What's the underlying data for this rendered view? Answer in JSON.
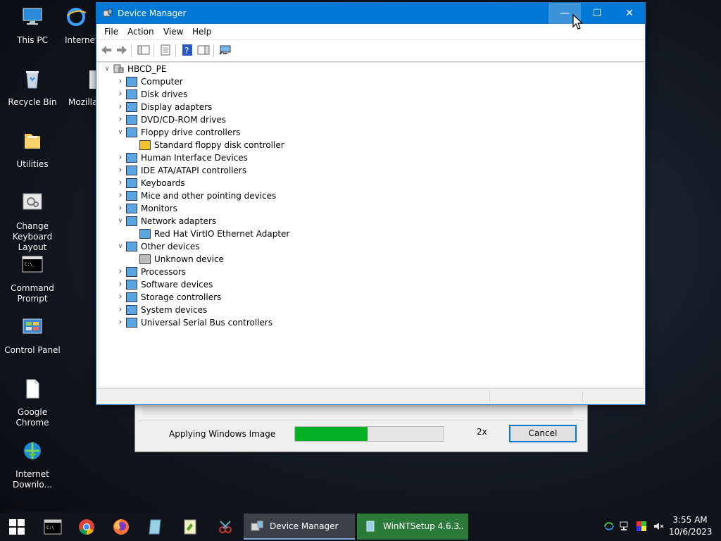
{
  "desktop": {
    "icons": [
      {
        "label": "This PC",
        "icon": "computer-icon"
      },
      {
        "label": "Internet",
        "icon": "internet-explorer-icon"
      },
      {
        "label": "Recycle Bin",
        "icon": "recycle-bin-icon"
      },
      {
        "label": "Mozilla",
        "icon": "mozilla-icon"
      },
      {
        "label": "Utilities",
        "icon": "folder-icon"
      },
      {
        "label": "Change Keyboard Layout",
        "icon": "keyboard-icon"
      },
      {
        "label": "Command Prompt",
        "icon": "terminal-icon"
      },
      {
        "label": "Control Panel",
        "icon": "control-panel-icon"
      },
      {
        "label": "Google Chrome",
        "icon": "file-icon"
      },
      {
        "label": "Internet Downlo...",
        "icon": "download-manager-icon"
      }
    ]
  },
  "background_window": {
    "status_label": "Applying Windows Image",
    "progress_fraction": 0.49,
    "speed_label": "2x",
    "cancel_label": "Cancel",
    "progress_color": "#06b025"
  },
  "device_manager": {
    "title": "Device Manager",
    "menu": [
      "File",
      "Action",
      "View",
      "Help"
    ],
    "toolbar": [
      "back-icon",
      "forward-icon",
      "show-hide-tree-icon",
      "properties-icon",
      "help-icon",
      "action-pane-icon",
      "scan-hardware-icon"
    ],
    "root": "HBCD_PE",
    "tree": [
      {
        "label": "Computer",
        "expanded": false,
        "icon": "monitor-icon",
        "children": []
      },
      {
        "label": "Disk drives",
        "expanded": false,
        "icon": "disk-drive-icon",
        "children": []
      },
      {
        "label": "Display adapters",
        "expanded": false,
        "icon": "display-adapter-icon",
        "children": []
      },
      {
        "label": "DVD/CD-ROM drives",
        "expanded": false,
        "icon": "dvd-drive-icon",
        "children": []
      },
      {
        "label": "Floppy drive controllers",
        "expanded": true,
        "icon": "floppy-controller-icon",
        "children": [
          {
            "label": "Standard floppy disk controller",
            "icon": "warning-device-icon"
          }
        ]
      },
      {
        "label": "Human Interface Devices",
        "expanded": false,
        "icon": "hid-icon",
        "children": []
      },
      {
        "label": "IDE ATA/ATAPI controllers",
        "expanded": false,
        "icon": "ide-controller-icon",
        "children": []
      },
      {
        "label": "Keyboards",
        "expanded": false,
        "icon": "keyboard-icon",
        "children": []
      },
      {
        "label": "Mice and other pointing devices",
        "expanded": false,
        "icon": "mouse-icon",
        "children": []
      },
      {
        "label": "Monitors",
        "expanded": false,
        "icon": "monitor-icon",
        "children": []
      },
      {
        "label": "Network adapters",
        "expanded": true,
        "icon": "network-adapter-icon",
        "children": [
          {
            "label": "Red Hat VirtIO Ethernet Adapter",
            "icon": "network-adapter-icon"
          }
        ]
      },
      {
        "label": "Other devices",
        "expanded": true,
        "icon": "unknown-device-icon",
        "children": [
          {
            "label": "Unknown device",
            "icon": "unknown-device-icon"
          }
        ]
      },
      {
        "label": "Processors",
        "expanded": false,
        "icon": "processor-icon",
        "children": []
      },
      {
        "label": "Software devices",
        "expanded": false,
        "icon": "software-device-icon",
        "children": []
      },
      {
        "label": "Storage controllers",
        "expanded": false,
        "icon": "storage-controller-icon",
        "children": []
      },
      {
        "label": "System devices",
        "expanded": false,
        "icon": "system-device-icon",
        "children": []
      },
      {
        "label": "Universal Serial Bus controllers",
        "expanded": false,
        "icon": "usb-icon",
        "children": []
      }
    ]
  },
  "taskbar": {
    "pinned": [
      "start-icon",
      "terminal-icon",
      "chrome-icon",
      "firefox-icon",
      "notepad-icon",
      "editor-icon",
      "snipping-icon"
    ],
    "tasks": [
      {
        "label": "Device Manager",
        "icon": "device-manager-icon"
      },
      {
        "label": "WinNTSetup 4.6.3",
        "icon": "winntsetup-icon",
        "suffix": "..."
      }
    ],
    "tray": [
      "refresh-icon",
      "network-icon",
      "color-icon",
      "volume-muted-icon"
    ],
    "time": "3:55 AM",
    "date": "10/6/2023"
  },
  "colors": {
    "accent": "#0078d7",
    "titlebar": "#0078d7",
    "taskbar": "#10141a"
  }
}
